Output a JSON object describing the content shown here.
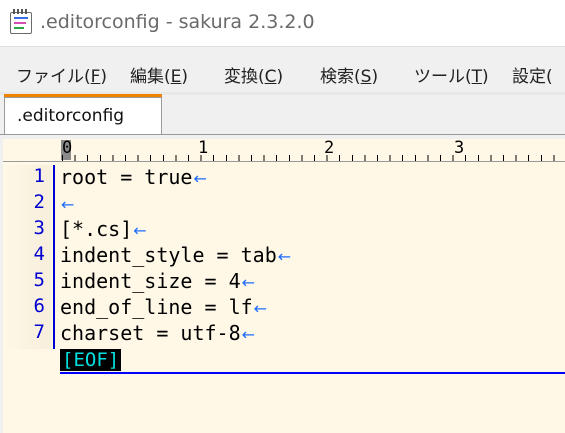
{
  "window": {
    "title": ".editorconfig - sakura 2.3.2.0",
    "icon": "sakura-notepad-icon"
  },
  "menu": {
    "items": [
      {
        "label": "ファイル(",
        "accel": "F",
        "tail": ")"
      },
      {
        "label": "編集(",
        "accel": "E",
        "tail": ")"
      },
      {
        "label": "変換(",
        "accel": "C",
        "tail": ")"
      },
      {
        "label": "検索(",
        "accel": "S",
        "tail": ")"
      },
      {
        "label": "ツール(",
        "accel": "T",
        "tail": ")"
      },
      {
        "label": "設定(",
        "accel": "",
        "tail": ""
      }
    ]
  },
  "tabs": [
    {
      "label": ".editorconfig",
      "active": true
    }
  ],
  "ruler": {
    "labels": [
      "0",
      "1",
      "2",
      "3"
    ]
  },
  "editor": {
    "lines": [
      {
        "num": "1",
        "text": "root = true",
        "eol": "←"
      },
      {
        "num": "2",
        "text": "",
        "eol": "←"
      },
      {
        "num": "3",
        "text": "[*.cs]",
        "eol": "←"
      },
      {
        "num": "4",
        "text": "indent_style = tab",
        "eol": "←"
      },
      {
        "num": "5",
        "text": "indent_size = 4",
        "eol": "←"
      },
      {
        "num": "6",
        "text": "end_of_line = lf",
        "eol": "←"
      },
      {
        "num": "7",
        "text": "charset = utf-8",
        "eol": "←"
      }
    ],
    "eof_marker": "[EOF]"
  },
  "colors": {
    "tab_accent": "#f08300",
    "editor_bg": "#fff8e6",
    "line_number": "#0000d0",
    "eol_arrow": "#1e6bff",
    "eof_fg": "#00e0e0"
  }
}
